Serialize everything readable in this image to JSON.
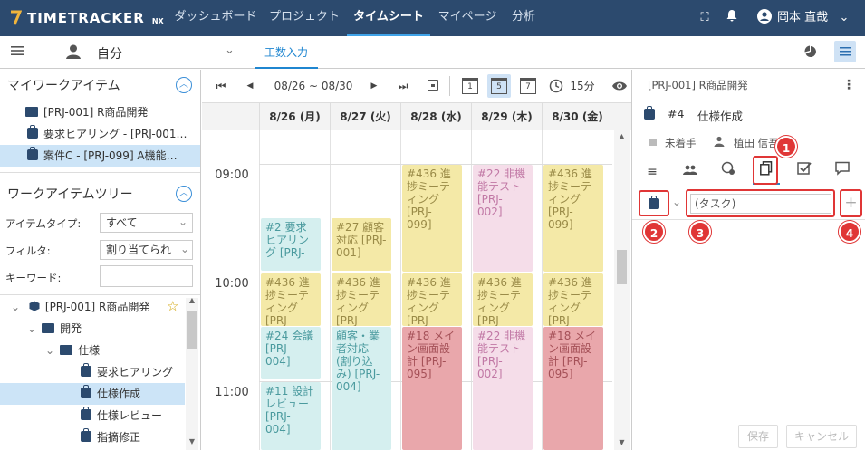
{
  "app": {
    "logo_text": "TIMETRACKER",
    "logo_suffix": "NX"
  },
  "nav": {
    "items": [
      {
        "label": "ダッシュボード"
      },
      {
        "label": "プロジェクト"
      },
      {
        "label": "タイムシート"
      },
      {
        "label": "マイページ"
      },
      {
        "label": "分析"
      }
    ],
    "active": "タイムシート",
    "user_name": "岡本 直哉"
  },
  "subbar": {
    "user_select": "自分",
    "tab_label": "工数入力"
  },
  "left": {
    "my_items_title": "マイワークアイテム",
    "my_items": [
      {
        "icon": "folder-icon",
        "label": "[PRJ-001] R商品開発"
      },
      {
        "icon": "bag-icon",
        "label": "要求ヒアリング - [PRJ-001…"
      },
      {
        "icon": "bag-icon",
        "label": "案件C - [PRJ-099] A機能…",
        "selected": true
      }
    ],
    "tree_title": "ワークアイテムツリー",
    "filters": [
      {
        "label": "アイテムタイプ:",
        "value": "すべて"
      },
      {
        "label": "フィルタ:",
        "value": "割り当てられ"
      },
      {
        "label": "キーワード:",
        "value": ""
      }
    ],
    "tree": [
      {
        "label": "[PRJ-001] R商品開発"
      },
      {
        "label": "開発"
      },
      {
        "label": "仕様"
      },
      {
        "label": "要求ヒアリング"
      },
      {
        "label": "仕様作成"
      },
      {
        "label": "仕様レビュー"
      },
      {
        "label": "指摘修正"
      }
    ]
  },
  "toolbar": {
    "range": "08/26 ~ 08/30",
    "interval": "15分",
    "view_days": [
      "1",
      "5",
      "7"
    ]
  },
  "calendar": {
    "days": [
      "8/26 (月)",
      "8/27 (火)",
      "8/28 (水)",
      "8/29 (木)",
      "8/30 (金)"
    ],
    "times": [
      "09:00",
      "10:00",
      "11:00"
    ],
    "events": [
      {
        "day": 0,
        "color": "cyan",
        "text": "#2 要求 ヒアリン グ [PRJ-"
      },
      {
        "day": 1,
        "color": "yellow",
        "text": "#27 顧客 対応 [PRJ- 001]"
      },
      {
        "day": 2,
        "color": "yellow",
        "text": "#436 進 捗ミーテ ィング [PRJ- 099]"
      },
      {
        "day": 3,
        "color": "pink",
        "text": "#22 非機 能テスト [PRJ- 002]"
      },
      {
        "day": 4,
        "color": "yellow",
        "text": "#436 進 捗ミーテ ィング [PRJ- 099]"
      },
      {
        "day": 0,
        "color": "yellow",
        "text": "#436 進 捗ミーテ ィング [PRJ-"
      },
      {
        "day": 1,
        "color": "yellow",
        "text": "#436 進 捗ミーテ ィング [PRJ-"
      },
      {
        "day": 2,
        "color": "yellow",
        "text": "#436 進 捗ミーテ ィング [PRJ-"
      },
      {
        "day": 3,
        "color": "yellow",
        "text": "#436 進 捗ミーテ ィング [PRJ-"
      },
      {
        "day": 4,
        "color": "yellow",
        "text": "#436 進 捗ミーテ ィング [PRJ-"
      },
      {
        "day": 0,
        "color": "cyan",
        "text": "#24 会議 [PRJ- 004]"
      },
      {
        "day": 1,
        "color": "cyan",
        "text": "顧客・業 者対応 (割り込 み) [PRJ- 004]"
      },
      {
        "day": 2,
        "color": "red",
        "text": "#18 メイ ン画面設 計 [PRJ- 095]"
      },
      {
        "day": 3,
        "color": "pink",
        "text": "#22 非機 能テスト [PRJ- 002]"
      },
      {
        "day": 4,
        "color": "red",
        "text": "#18 メイ ン画面設 計 [PRJ- 095]"
      },
      {
        "day": 0,
        "color": "cyan",
        "text": "#11 設計 レビュー [PRJ- 004]"
      }
    ]
  },
  "detail": {
    "project": "[PRJ-001] R商品開発",
    "item_no": "#4",
    "item_title": "仕様作成",
    "status": "未着手",
    "assignee": "植田 信吾",
    "task_placeholder": "(タスク)",
    "save_label": "保存",
    "cancel_label": "キャンセル",
    "callouts": [
      "1",
      "2",
      "3",
      "4"
    ],
    "accent": "#e03636"
  }
}
